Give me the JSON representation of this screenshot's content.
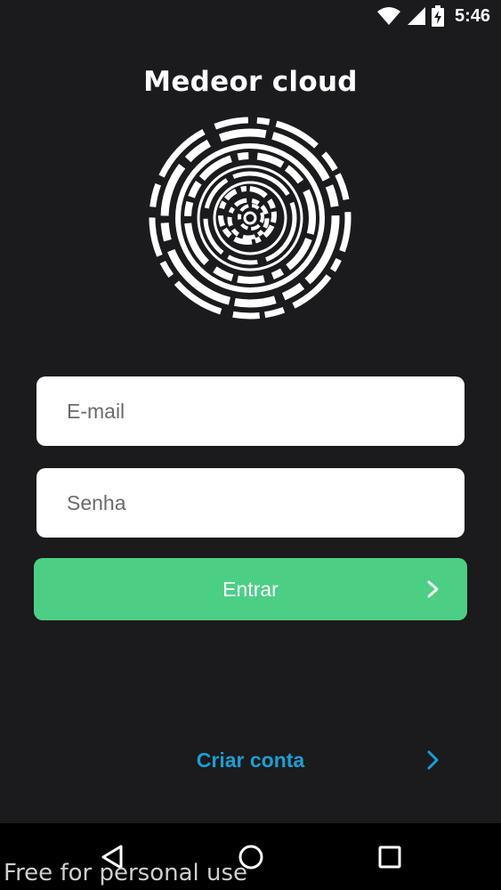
{
  "status_bar": {
    "time": "5:46",
    "icons": [
      "wifi-icon",
      "signal-icon",
      "battery-charging-icon"
    ]
  },
  "app": {
    "title": "Medeor cloud",
    "logo": "concentric-circuit-logo"
  },
  "login_form": {
    "email_placeholder": "E-mail",
    "email_value": "",
    "password_placeholder": "Senha",
    "password_value": "",
    "submit_label": "Entrar",
    "submit_icon": "chevron-right-icon"
  },
  "create_account": {
    "label": "Criar conta",
    "icon": "chevron-right-icon"
  },
  "nav_bar": {
    "buttons": [
      "back-icon",
      "home-icon",
      "recent-apps-icon"
    ]
  },
  "watermark": "Free for personal use",
  "colors": {
    "background": "#1b1a1d",
    "primary_button": "#4ccf85",
    "link": "#1aa0d1",
    "field": "#ffffff",
    "nav_bar": "#000000"
  }
}
